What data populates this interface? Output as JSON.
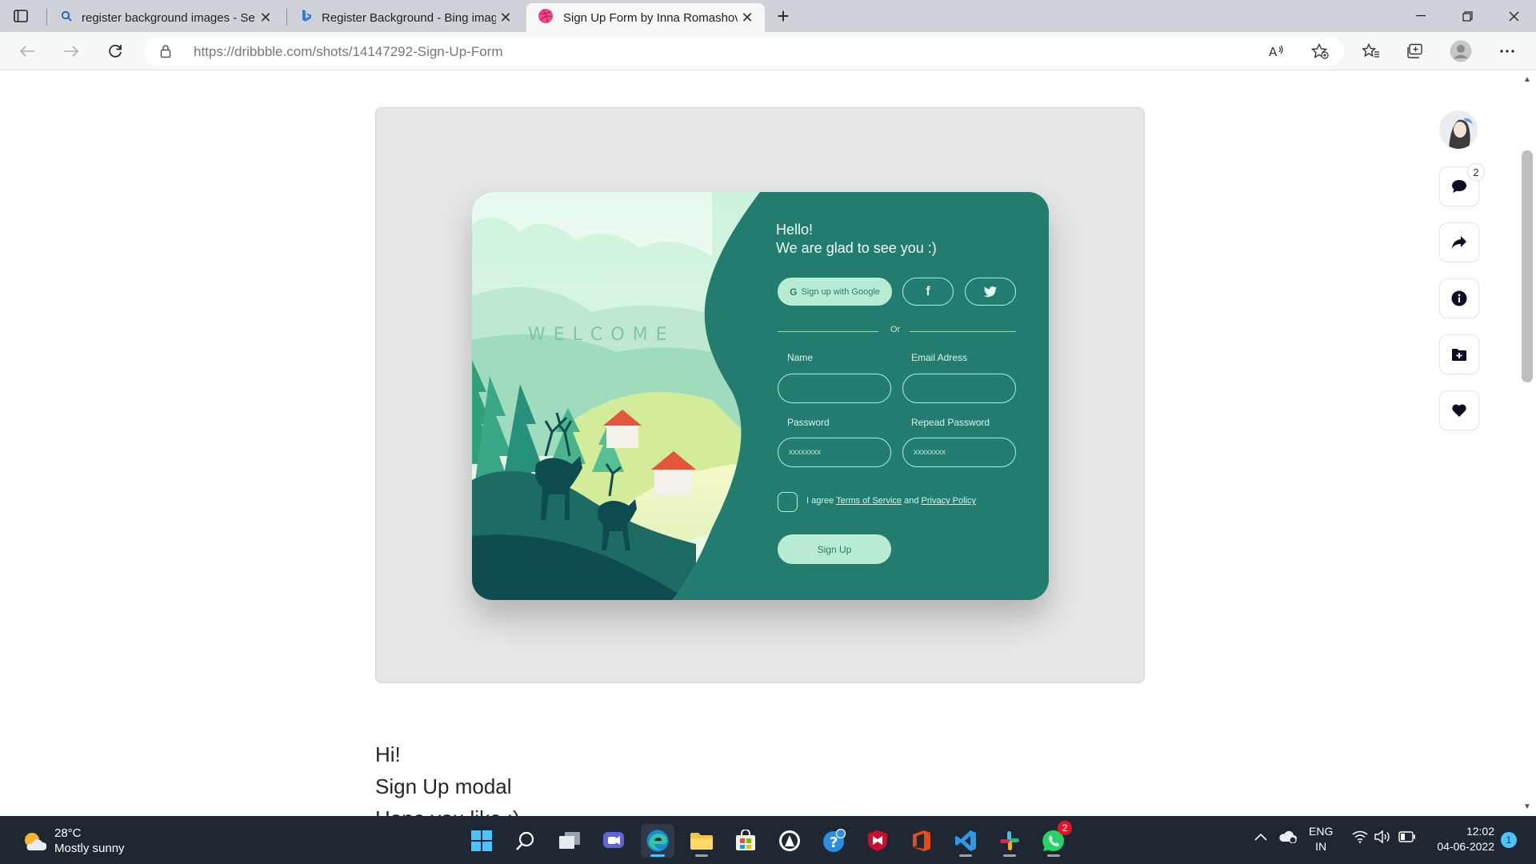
{
  "browser": {
    "tabs": [
      {
        "title": "register background images - Se",
        "icon": "search-icon"
      },
      {
        "title": "Register Background - Bing imag",
        "icon": "bing-icon"
      },
      {
        "title": "Sign Up Form by Inna Romashov",
        "icon": "dribbble-icon"
      }
    ],
    "url_host": "https://dribbble.com",
    "url_path": "/shots/14147292-Sign-Up-Form"
  },
  "card": {
    "welcome": "WELCOME",
    "hello_line1": "Hello!",
    "hello_line2": "We are glad to see you :)",
    "google_label": "Sign up with Google",
    "facebook_glyph": "f",
    "or": "Or",
    "name_label": "Name",
    "email_label": "Email Adress",
    "password_label": "Password",
    "repeat_label": "Repead Password",
    "password_mask": "xxxxxxxx",
    "repeat_mask": "xxxxxxxx",
    "agree_prefix": "I agree",
    "terms": "Terms of Service",
    "and": "and",
    "privacy": "Privacy Policy",
    "signup": "Sign Up",
    "accent": "#237c70",
    "mint": "#b8ecd2"
  },
  "description": {
    "line1": "Hi!",
    "line2": "Sign Up modal",
    "line3": "Hope you like :)"
  },
  "sidebar": {
    "comments_count": "2"
  },
  "taskbar": {
    "temp": "28°C",
    "condition": "Mostly sunny",
    "lang1": "ENG",
    "lang2": "IN",
    "time": "12:02",
    "date": "04-06-2022",
    "whatsapp_badge": "2",
    "notifications": "1"
  }
}
